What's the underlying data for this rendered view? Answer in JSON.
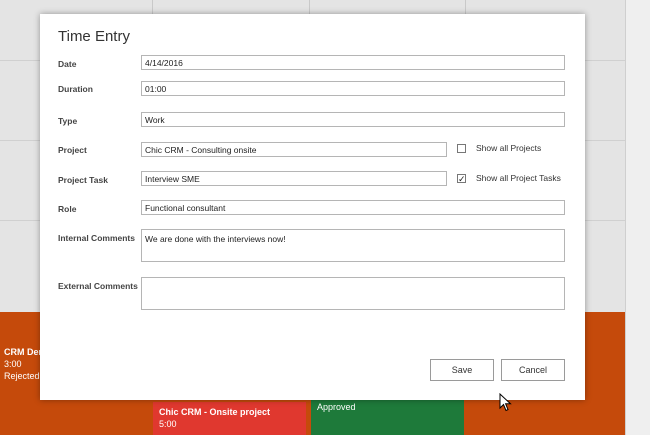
{
  "dialog": {
    "title": "Time Entry",
    "fields": {
      "date": {
        "label": "Date",
        "value": "4/14/2016"
      },
      "duration": {
        "label": "Duration",
        "value": "01:00"
      },
      "type": {
        "label": "Type",
        "value": "Work"
      },
      "project": {
        "label": "Project",
        "value": "Chic CRM - Consulting onsite"
      },
      "project_task": {
        "label": "Project Task",
        "value": "Interview SME"
      },
      "role": {
        "label": "Role",
        "value": "Functional consultant"
      },
      "internal_comments": {
        "label": "Internal Comments",
        "value": "We are done with the interviews now!"
      },
      "external_comments": {
        "label": "External Comments",
        "value": ""
      }
    },
    "checkboxes": {
      "show_all_projects": {
        "label": "Show all Projects",
        "checked": false
      },
      "show_all_project_tasks": {
        "label": "Show all Project Tasks",
        "checked": true
      }
    },
    "buttons": {
      "save": "Save",
      "cancel": "Cancel"
    }
  },
  "background": {
    "card_left": {
      "title": "CRM Der",
      "duration": "3:00",
      "status": "Rejected"
    },
    "card_red": {
      "title": "Chic CRM - Onsite project",
      "duration": "5:00"
    },
    "card_green": {
      "status": "Approved"
    }
  },
  "colors": {
    "orange": "#c54a0b",
    "red": "#e0382f",
    "green": "#1e7a3a"
  }
}
